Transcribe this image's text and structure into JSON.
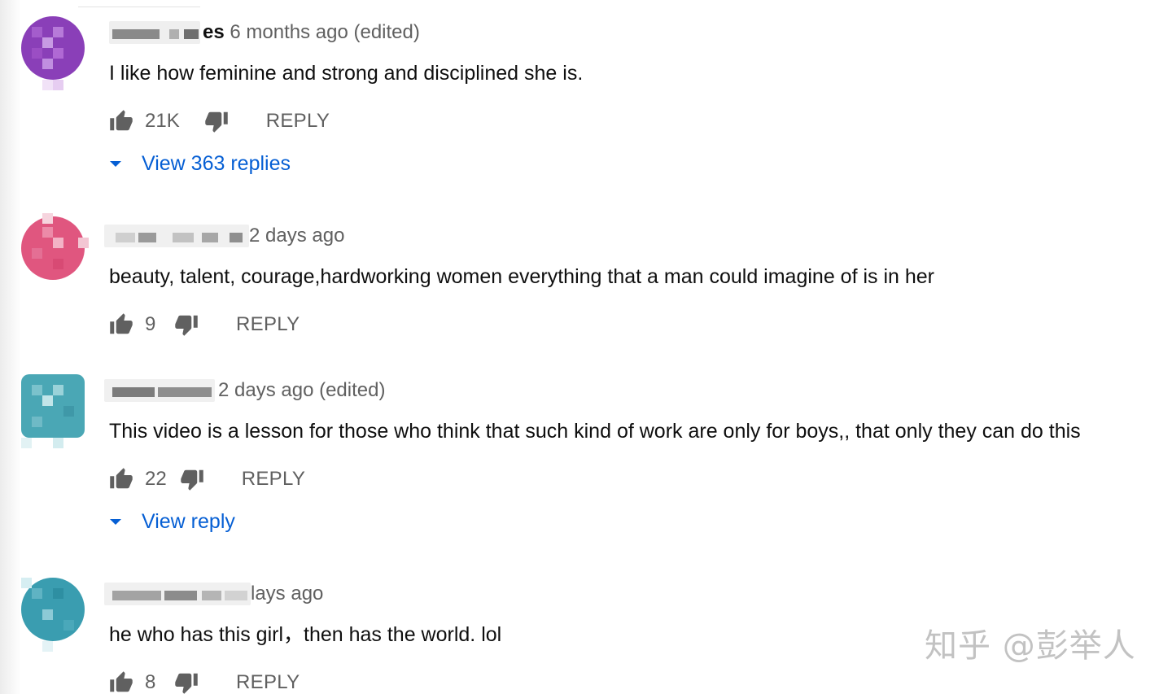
{
  "comments": [
    {
      "author_visible": "es",
      "time": "6 months ago (edited)",
      "text": "I like how feminine and strong and disciplined she is.",
      "likes": "21K",
      "reply_label": "REPLY",
      "view_replies": "View 363 replies",
      "avatar_color": "#8a3fb8"
    },
    {
      "author_visible": "",
      "time": "2 days ago",
      "text": "beauty, talent, courage,hardworking women everything that a man could imagine of is in her",
      "likes": "9",
      "reply_label": "REPLY",
      "avatar_color": "#e0567f"
    },
    {
      "author_visible": "",
      "time": "2 days ago (edited)",
      "text": "This video is a lesson for those who think that such kind of work are only for boys,, that only they can do this",
      "likes": "22",
      "reply_label": "REPLY",
      "view_replies": "View reply",
      "avatar_color": "#4aa7b5"
    },
    {
      "author_visible": "",
      "time": "lays ago",
      "text": "he who has this girl，then has the world. lol",
      "likes": "8",
      "reply_label": "REPLY",
      "avatar_color": "#3a9db0"
    }
  ],
  "watermark": "知乎 @彭举人",
  "colors": {
    "link_blue": "#065fd4",
    "secondary_text": "#606060",
    "primary_text": "#0f0f0f"
  },
  "icons": [
    "thumb-up-icon",
    "thumb-down-icon",
    "caret-down-icon"
  ]
}
